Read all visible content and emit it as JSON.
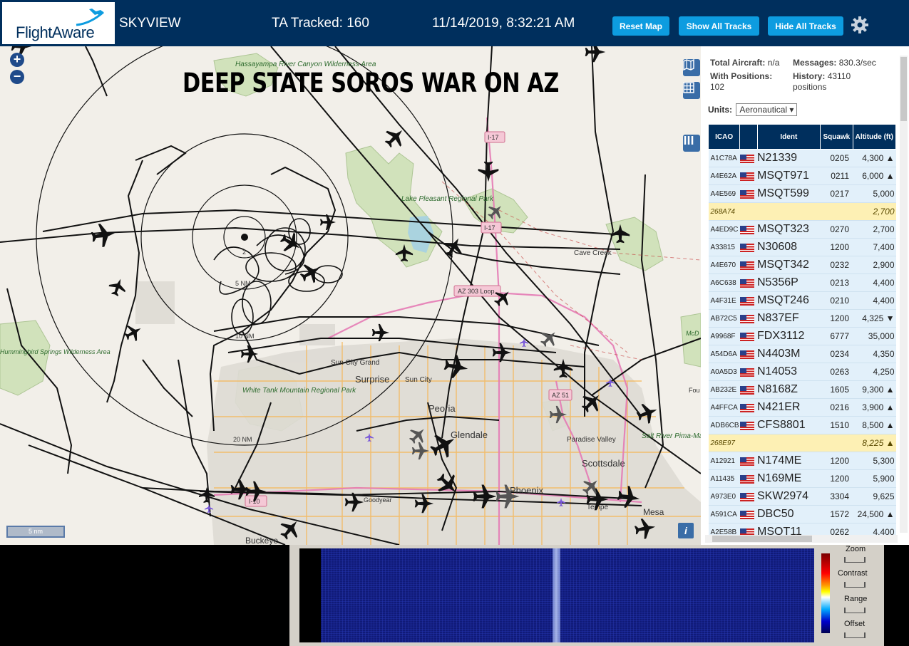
{
  "header": {
    "logo": "FlightAware",
    "title": "SKYVIEW",
    "tracked": "TA Tracked: 160",
    "datetime": "11/14/2019, 8:32:21 AM",
    "buttons": {
      "reset": "Reset Map",
      "show": "Show All Tracks",
      "hide": "Hide All Tracks"
    },
    "colors": {
      "bar": "#002f5d",
      "button": "#0d9ce0"
    }
  },
  "map": {
    "overlay_title": "DEEP STATE SOROS WAR ON AZ",
    "zoom_in": "+",
    "zoom_out": "−",
    "scale": "5 nm",
    "info": "i",
    "labels": {
      "hassayampa": "Hassayampa River Canyon Wilderness Area",
      "lake_pleasant": "Lake Pleasant Regional Park",
      "cave_creek": "Cave Creek",
      "sun_city_grand": "Sun City Grand",
      "surprise": "Surprise",
      "sun_city": "Sun City",
      "white_tank": "White Tank Mountain Regional Park",
      "peoria": "Peoria",
      "glendale": "Glendale",
      "paradise_valley": "Paradise Valley",
      "scottsdale": "Scottsdale",
      "phoenix": "Phoenix",
      "tempe": "Tempe",
      "mesa": "Mesa",
      "goodyear": "Goodyear",
      "buckeye": "Buckeye",
      "hummingbird": "Hummingbird Springs Wilderness Area",
      "salt_river": "Salt River Pima-Maricopa Indian Community",
      "mcdowell": "McD Mou Regi Pa",
      "fou": "Fou",
      "i17a": "I-17",
      "i17b": "I-17",
      "az303": "AZ 303 Loop",
      "az51": "AZ 51",
      "i10": "I-10",
      "r2": "2",
      "r5": "5 NM",
      "r10": "10 NM",
      "r20": "20 NM"
    }
  },
  "sidebar": {
    "total_label": "Total Aircraft:",
    "total_value": "n/a",
    "positions_label": "With Positions:",
    "positions_value": "102",
    "messages_label": "Messages:",
    "messages_value": "830.3/sec",
    "history_label": "History:",
    "history_value": "43110 positions",
    "units_label": "Units:",
    "units_value": "Aeronautical",
    "columns": [
      "ICAO",
      "",
      "Ident",
      "Squawk",
      "Altitude (ft)"
    ],
    "rows": [
      {
        "icao": "A1C78A",
        "ident": "N21339",
        "squawk": "0205",
        "alt": "4,300 ▲",
        "flag": true,
        "highlight": false
      },
      {
        "icao": "A4E62A",
        "ident": "MSQT971",
        "squawk": "0211",
        "alt": "6,000 ▲",
        "flag": true,
        "highlight": false
      },
      {
        "icao": "A4E569",
        "ident": "MSQT599",
        "squawk": "0217",
        "alt": "5,000",
        "flag": true,
        "highlight": false
      },
      {
        "icao": "268A74",
        "ident": "",
        "squawk": "",
        "alt": "2,700",
        "flag": false,
        "highlight": true
      },
      {
        "icao": "A4ED9C",
        "ident": "MSQT323",
        "squawk": "0270",
        "alt": "2,700",
        "flag": true,
        "highlight": false
      },
      {
        "icao": "A33815",
        "ident": "N30608",
        "squawk": "1200",
        "alt": "7,400",
        "flag": true,
        "highlight": false
      },
      {
        "icao": "A4E670",
        "ident": "MSQT342",
        "squawk": "0232",
        "alt": "2,900",
        "flag": true,
        "highlight": false
      },
      {
        "icao": "A6C638",
        "ident": "N5356P",
        "squawk": "0213",
        "alt": "4,400",
        "flag": true,
        "highlight": false
      },
      {
        "icao": "A4F31E",
        "ident": "MSQT246",
        "squawk": "0210",
        "alt": "4,400",
        "flag": true,
        "highlight": false
      },
      {
        "icao": "AB72C5",
        "ident": "N837EF",
        "squawk": "1200",
        "alt": "4,325 ▼",
        "flag": true,
        "highlight": false
      },
      {
        "icao": "A9968F",
        "ident": "FDX3112",
        "squawk": "6777",
        "alt": "35,000",
        "flag": true,
        "highlight": false
      },
      {
        "icao": "A54D6A",
        "ident": "N4403M",
        "squawk": "0234",
        "alt": "4,350",
        "flag": true,
        "highlight": false
      },
      {
        "icao": "A0A5D3",
        "ident": "N14053",
        "squawk": "0263",
        "alt": "4,250",
        "flag": true,
        "highlight": false
      },
      {
        "icao": "AB232E",
        "ident": "N8168Z",
        "squawk": "1605",
        "alt": "9,300 ▲",
        "flag": true,
        "highlight": false
      },
      {
        "icao": "A4FFCA",
        "ident": "N421ER",
        "squawk": "0216",
        "alt": "3,900 ▲",
        "flag": true,
        "highlight": false
      },
      {
        "icao": "ADB6CB",
        "ident": "CFS8801",
        "squawk": "1510",
        "alt": "8,500 ▲",
        "flag": true,
        "highlight": false
      },
      {
        "icao": "268E97",
        "ident": "",
        "squawk": "",
        "alt": "8,225 ▲",
        "flag": false,
        "highlight": true
      },
      {
        "icao": "A12921",
        "ident": "N174ME",
        "squawk": "1200",
        "alt": "5,300",
        "flag": true,
        "highlight": false
      },
      {
        "icao": "A11435",
        "ident": "N169ME",
        "squawk": "1200",
        "alt": "5,900",
        "flag": true,
        "highlight": false
      },
      {
        "icao": "A973E0",
        "ident": "SKW2974",
        "squawk": "3304",
        "alt": "9,625",
        "flag": true,
        "highlight": false
      },
      {
        "icao": "A591CA",
        "ident": "DBC50",
        "squawk": "1572",
        "alt": "24,500 ▲",
        "flag": true,
        "highlight": false
      },
      {
        "icao": "A2E58B",
        "ident": "MSQT11",
        "squawk": "0262",
        "alt": "4,400",
        "flag": true,
        "highlight": false
      }
    ]
  },
  "spectrum": {
    "zoom": "Zoom",
    "contrast": "Contrast",
    "range": "Range",
    "offset": "Offset"
  }
}
